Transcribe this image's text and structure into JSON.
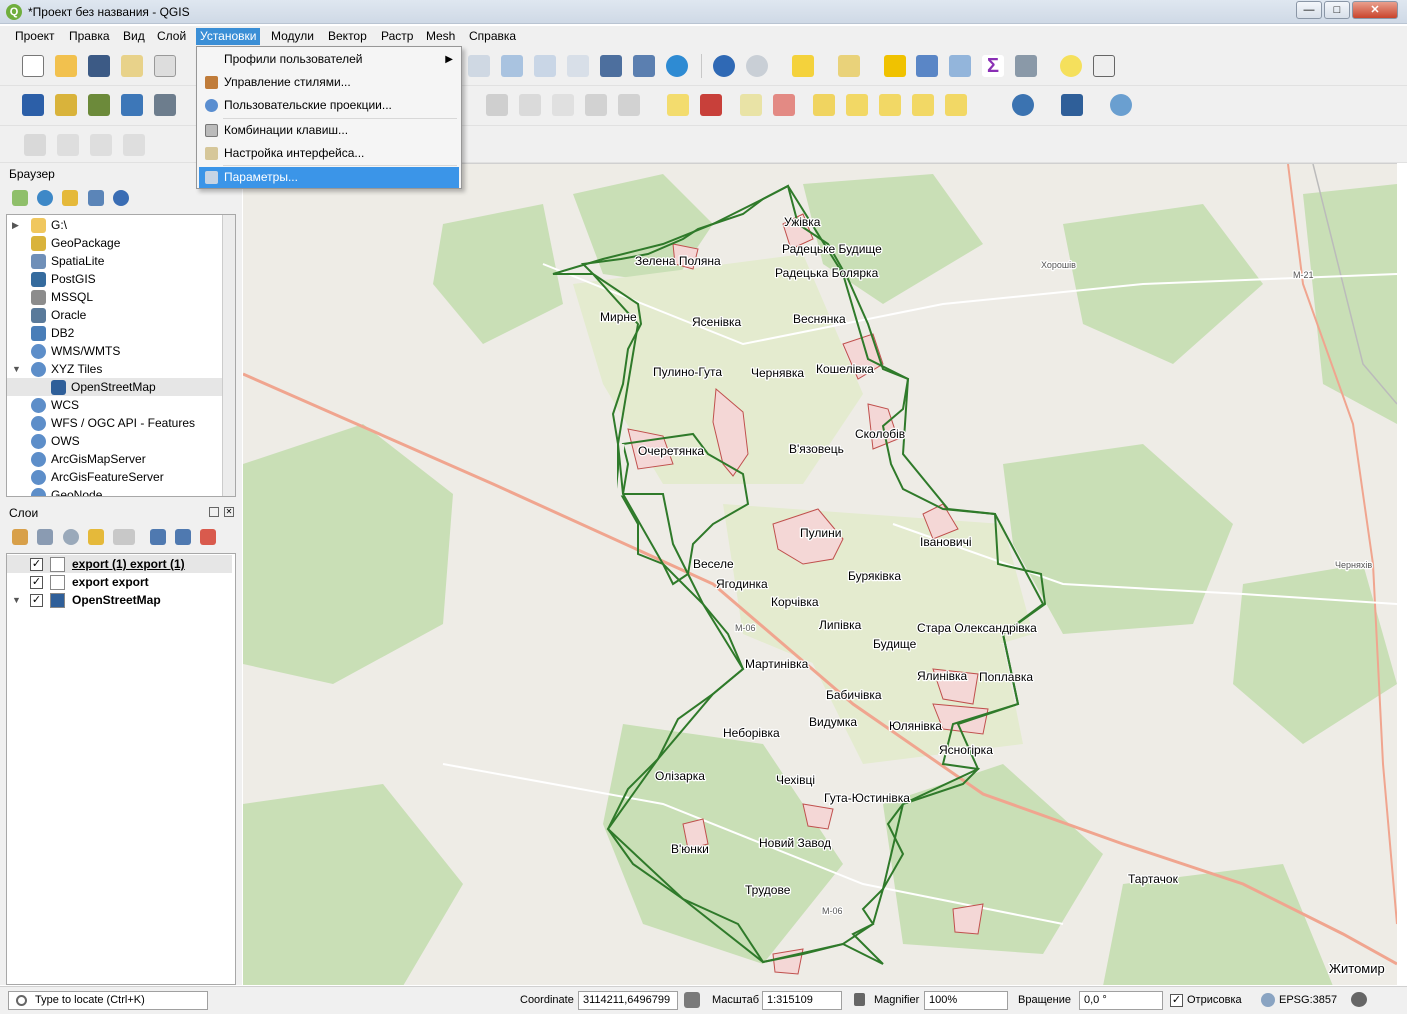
{
  "window": {
    "title": "*Проект без названия - QGIS",
    "controls": {
      "minimize": "—",
      "maximize": "□",
      "close": "✕"
    },
    "accent_color": "#3b8fd6"
  },
  "menubar": {
    "items": [
      "Проект",
      "Правка",
      "Вид",
      "Слой",
      "Установки",
      "Модули",
      "Вектор",
      "Растр",
      "Mesh",
      "Справка"
    ],
    "active": "Установки"
  },
  "dropdown": {
    "items": [
      {
        "label": "Профили пользователей",
        "has_submenu": true
      },
      {
        "label": "Управление стилями..."
      },
      {
        "label": "Пользовательские проекции..."
      },
      {
        "label": "Комбинации клавиш..."
      },
      {
        "label": "Настройка интерфейса..."
      },
      {
        "label": "Параметры...",
        "highlighted": true
      }
    ]
  },
  "browser": {
    "title": "Браузер",
    "items": [
      {
        "label": "G:\\",
        "icon": "folder-icon"
      },
      {
        "label": "GeoPackage",
        "icon": "geopackage-icon"
      },
      {
        "label": "SpatiaLite",
        "icon": "spatialite-icon"
      },
      {
        "label": "PostGIS",
        "icon": "postgis-icon"
      },
      {
        "label": "MSSQL",
        "icon": "mssql-icon"
      },
      {
        "label": "Oracle",
        "icon": "oracle-icon"
      },
      {
        "label": "DB2",
        "icon": "db2-icon"
      },
      {
        "label": "WMS/WMTS",
        "icon": "globe-icon"
      },
      {
        "label": "XYZ Tiles",
        "icon": "globe-icon",
        "expanded": true
      },
      {
        "label": "OpenStreetMap",
        "icon": "tiles-icon",
        "child": true,
        "selected": true
      },
      {
        "label": "WCS",
        "icon": "globe-icon"
      },
      {
        "label": "WFS / OGC API - Features",
        "icon": "globe-icon"
      },
      {
        "label": "OWS",
        "icon": "globe-icon"
      },
      {
        "label": "ArcGisMapServer",
        "icon": "globe-icon"
      },
      {
        "label": "ArcGisFeatureServer",
        "icon": "globe-icon"
      },
      {
        "label": "GeoNode",
        "icon": "globe-icon"
      }
    ]
  },
  "layers": {
    "title": "Слои",
    "items": [
      {
        "label": "export (1) export (1)",
        "checked": "✓",
        "underline": true
      },
      {
        "label": "export export",
        "checked": "✓"
      },
      {
        "label": "OpenStreetMap",
        "checked": "✓",
        "expandable": true
      }
    ]
  },
  "map": {
    "boundary_color": "#2f7a2a",
    "settlement_color": "#c0504d",
    "road_color": "#f0a58f",
    "labels": [
      {
        "text": "Ужівка"
      },
      {
        "text": "Радецьке Будище"
      },
      {
        "text": "Зелена Поляна"
      },
      {
        "text": "Радецька Болярка"
      },
      {
        "text": "Хорошів"
      },
      {
        "text": "М-21"
      },
      {
        "text": "Мирне"
      },
      {
        "text": "Ясенівка"
      },
      {
        "text": "Веснянка"
      },
      {
        "text": "Пулино-Гута"
      },
      {
        "text": "Чернявка"
      },
      {
        "text": "Кошелівка"
      },
      {
        "text": "Сколобів"
      },
      {
        "text": "Очеретянка"
      },
      {
        "text": "В'язовець"
      },
      {
        "text": "Пулини"
      },
      {
        "text": "Івановичі"
      },
      {
        "text": "Веселе"
      },
      {
        "text": "Ягодинка"
      },
      {
        "text": "Буряківка"
      },
      {
        "text": "Черняхів"
      },
      {
        "text": "Корчівка"
      },
      {
        "text": "М-06"
      },
      {
        "text": "Липівка"
      },
      {
        "text": "Стара Олександрівка"
      },
      {
        "text": "Будище"
      },
      {
        "text": "Мартинівка"
      },
      {
        "text": "Ялинівка"
      },
      {
        "text": "Поплавка"
      },
      {
        "text": "Бабичівка"
      },
      {
        "text": "Видумка"
      },
      {
        "text": "Юлянівка"
      },
      {
        "text": "Неборівка"
      },
      {
        "text": "Ясногірка"
      },
      {
        "text": "Олізарка"
      },
      {
        "text": "Чехівці"
      },
      {
        "text": "Гута-Юстинівка"
      },
      {
        "text": "В'юнки"
      },
      {
        "text": "Новий Завод"
      },
      {
        "text": "Трудове"
      },
      {
        "text": "М-06"
      },
      {
        "text": "Тартачок"
      },
      {
        "text": "Житомир"
      }
    ]
  },
  "statusbar": {
    "locator_placeholder": "Type to locate (Ctrl+K)",
    "coordinate_label": "Coordinate",
    "coordinate_value": "3114211,6496799",
    "scale_label": "Масштаб",
    "scale_value": "1:315109",
    "magnifier_label": "Magnifier",
    "magnifier_value": "100%",
    "rotation_label": "Вращение",
    "rotation_value": "0,0 °",
    "render_label": "Отрисовка",
    "render_checked": "✓",
    "crs": "EPSG:3857"
  }
}
